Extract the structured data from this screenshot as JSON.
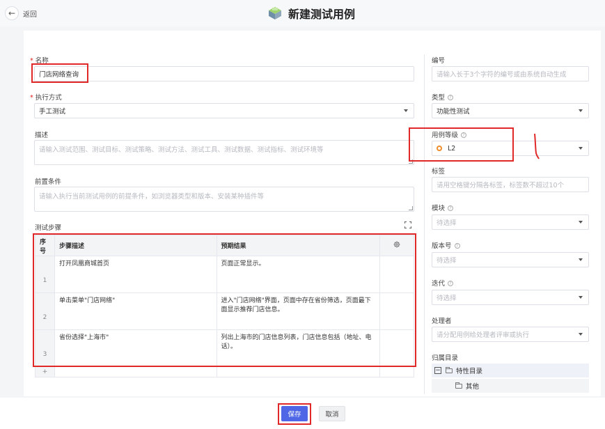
{
  "header": {
    "back_label": "返回",
    "title": "新建测试用例"
  },
  "form_left": {
    "name": {
      "label": "名称",
      "value": "门店网络查询"
    },
    "exec_mode": {
      "label": "执行方式",
      "value": "手工测试"
    },
    "description": {
      "label": "描述",
      "placeholder": "请输入测试范围、测试目标、测试策略、测试方法、测试工具、测试数据、测试指标、测试环境等"
    },
    "precondition": {
      "label": "前置条件",
      "placeholder": "请输入执行当前测试用例的前提条件，如浏览器类型和版本、安装某种插件等"
    },
    "steps_label": "测试步骤"
  },
  "steps_table": {
    "headers": {
      "index": "序号",
      "step": "步骤描述",
      "expected": "预期结果"
    },
    "rows": [
      {
        "index": "1",
        "step": "打开凤凰商城首页",
        "expected": "页面正常显示。"
      },
      {
        "index": "2",
        "step": "单击菜单\"门店网络\"",
        "expected": "进入\"门店网络\"界面，页面中存在省份筛选，页面最下面显示推荐门店信息。"
      },
      {
        "index": "3",
        "step": "省份选择\"上海市\"",
        "expected": "列出上海市的门店信息列表，门店信息包括（地址、电话）。"
      }
    ],
    "empty_index": "+"
  },
  "form_right": {
    "number": {
      "label": "编号",
      "placeholder": "请输入长于3个字符的编号或由系统自动生成"
    },
    "type": {
      "label": "类型",
      "value": "功能性测试"
    },
    "level": {
      "label": "用例等级",
      "value": "L2"
    },
    "tags": {
      "label": "标签",
      "placeholder": "请用空格键分隔各标签，标签数不超过10个"
    },
    "module": {
      "label": "模块",
      "placeholder": "待选择"
    },
    "version": {
      "label": "版本号",
      "placeholder": "待选择"
    },
    "iteration": {
      "label": "迭代",
      "placeholder": "待选择"
    },
    "handler": {
      "label": "处理者",
      "placeholder": "请分配用例给处理者评审或执行"
    },
    "directory": {
      "label": "归属目录",
      "root": "特性目录",
      "child": "其他"
    }
  },
  "footer": {
    "save_label": "保存",
    "cancel_label": "取消"
  },
  "colors": {
    "primary": "#4f67e6",
    "annotation_red": "#e02828",
    "level_dot": "#f08c2a"
  }
}
